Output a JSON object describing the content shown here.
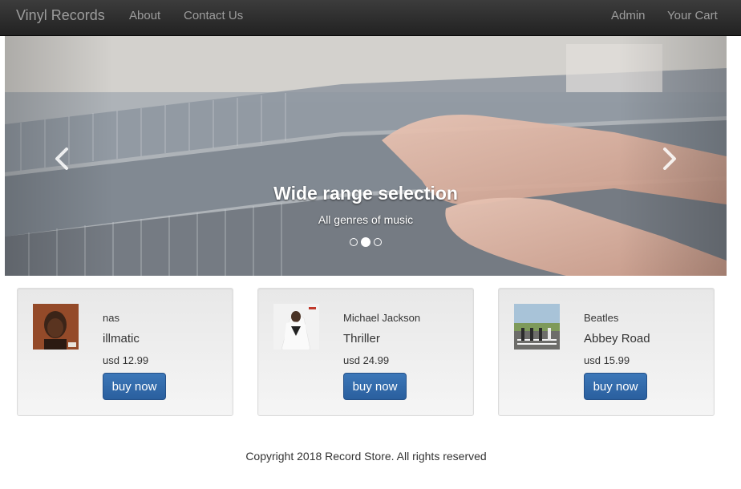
{
  "navbar": {
    "brand": "Vinyl Records",
    "about": "About",
    "contact": "Contact Us",
    "admin": "Admin",
    "cart": "Your Cart"
  },
  "carousel": {
    "title": "Wide range selection",
    "subtitle": "All genres of music",
    "active_slide": 2,
    "slide_count": 3
  },
  "products": [
    {
      "artist": "nas",
      "album": "illmatic",
      "price": "usd 12.99",
      "button": "buy now",
      "cover_icon": "illmatic-cover-icon"
    },
    {
      "artist": "Michael Jackson",
      "album": "Thriller",
      "price": "usd 24.99",
      "button": "buy now",
      "cover_icon": "thriller-cover-icon"
    },
    {
      "artist": "Beatles",
      "album": "Abbey Road",
      "price": "usd 15.99",
      "button": "buy now",
      "cover_icon": "abbey-road-cover-icon"
    }
  ],
  "footer": {
    "copyright": "Copyright 2018 Record Store. All rights reserved"
  },
  "colors": {
    "navbar": "#222222",
    "nav_text": "#9d9d9d",
    "button": "#2f69a8"
  }
}
